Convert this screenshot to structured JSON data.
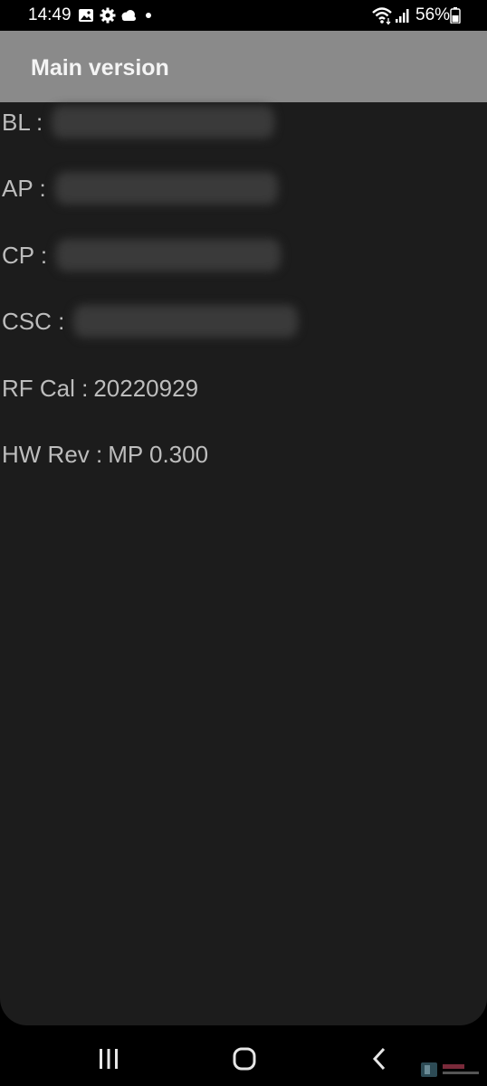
{
  "status_bar": {
    "time": "14:49",
    "battery_percent": "56%",
    "icons": [
      "gallery-icon",
      "settings-icon",
      "cloud-icon",
      "dot-icon",
      "wifi-icon",
      "signal-icon",
      "battery-icon"
    ]
  },
  "app_bar": {
    "title": "Main version"
  },
  "rows": [
    {
      "label": "BL :",
      "value": ""
    },
    {
      "label": "AP :",
      "value": ""
    },
    {
      "label": "CP :",
      "value": ""
    },
    {
      "label": "CSC :",
      "value": ""
    },
    {
      "label": "RF Cal :",
      "value": "20220929"
    },
    {
      "label": "HW Rev :",
      "value": "MP 0.300"
    }
  ],
  "nav_bar": {
    "buttons": [
      "recent-apps-icon",
      "home-icon",
      "back-icon"
    ]
  },
  "colors": {
    "app_bar": "#8a8a8a",
    "content_bg": "#1c1c1c",
    "text": "#bdbdbd"
  }
}
